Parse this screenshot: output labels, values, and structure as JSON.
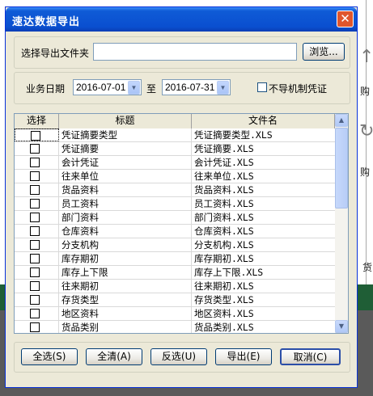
{
  "window": {
    "title": "速达数据导出",
    "close_symbol": "✕"
  },
  "folder": {
    "label": "选择导出文件夹",
    "value": "",
    "browse_label": "浏览..."
  },
  "date": {
    "label": "业务日期",
    "from": "2016-07-01",
    "to_label": "至",
    "to": "2016-07-31",
    "no_export_label": "不导机制凭证"
  },
  "table": {
    "headers": [
      "选择",
      "标题",
      "文件名"
    ],
    "rows": [
      {
        "title": "凭证摘要类型",
        "file": "凭证摘要类型.XLS"
      },
      {
        "title": "凭证摘要",
        "file": "凭证摘要.XLS"
      },
      {
        "title": "会计凭证",
        "file": "会计凭证.XLS"
      },
      {
        "title": "往来单位",
        "file": "往来单位.XLS"
      },
      {
        "title": "货品资料",
        "file": "货品资料.XLS"
      },
      {
        "title": "员工资料",
        "file": "员工资料.XLS"
      },
      {
        "title": "部门资料",
        "file": "部门资料.XLS"
      },
      {
        "title": "仓库资料",
        "file": "仓库资料.XLS"
      },
      {
        "title": "分支机构",
        "file": "分支机构.XLS"
      },
      {
        "title": "库存期初",
        "file": "库存期初.XLS"
      },
      {
        "title": "库存上下限",
        "file": "库存上下限.XLS"
      },
      {
        "title": "往来期初",
        "file": "往来期初.XLS"
      },
      {
        "title": "存货类型",
        "file": "存货类型.XLS"
      },
      {
        "title": "地区资料",
        "file": "地区资料.XLS"
      },
      {
        "title": "货品类别",
        "file": "货品类别.XLS"
      }
    ]
  },
  "buttons": {
    "select_all": "全选(S)",
    "clear_all": "全清(A)",
    "invert": "反选(U)",
    "export": "导出(E)",
    "cancel": "取消(C)"
  },
  "background": {
    "label1": "购",
    "label2": "购",
    "label3": "货"
  }
}
